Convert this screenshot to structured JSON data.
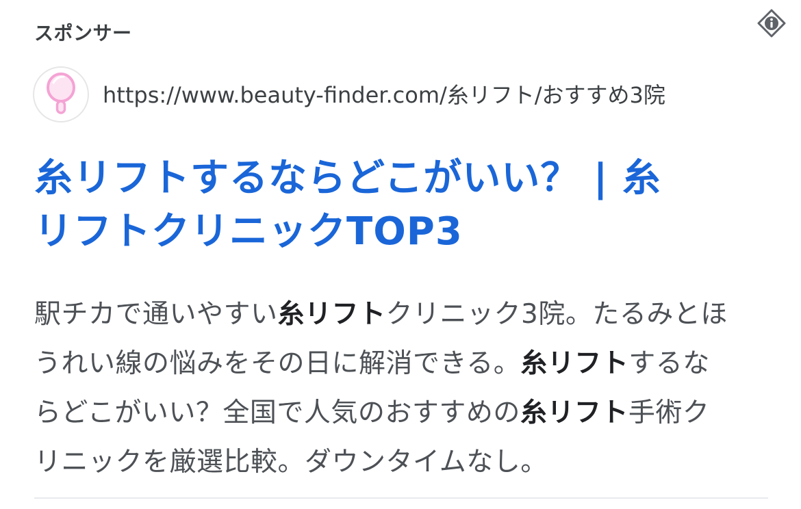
{
  "ad": {
    "sponsor_label": "スポンサー",
    "display_url": "https://www.beauty-finder.com/糸リフト/おすすめ3院",
    "headline": {
      "line1": "糸リフトするならどこがいい？ | 糸",
      "line2": "リフトクリニックTOP3"
    },
    "description": {
      "l1_a": "駅チカで通いやすい",
      "l1_b": "糸リフト",
      "l1_c": "クリニック3院。たるみとほ",
      "l2_a": "うれい線の悩みをその日に解消できる。",
      "l2_b": "糸リフト",
      "l2_c": "するな",
      "l3_a": "らどこがいい？全国で人気のおすすめの",
      "l3_b": "糸リフト",
      "l3_c": "手術ク",
      "l4_a": "リニックを厳選比較。ダウンタイムなし。"
    },
    "icons": {
      "info": "info-icon",
      "favicon": "hand-mirror-icon"
    },
    "colors": {
      "headline": "#1a66d8",
      "favicon_accent": "#f4a3d4"
    }
  }
}
